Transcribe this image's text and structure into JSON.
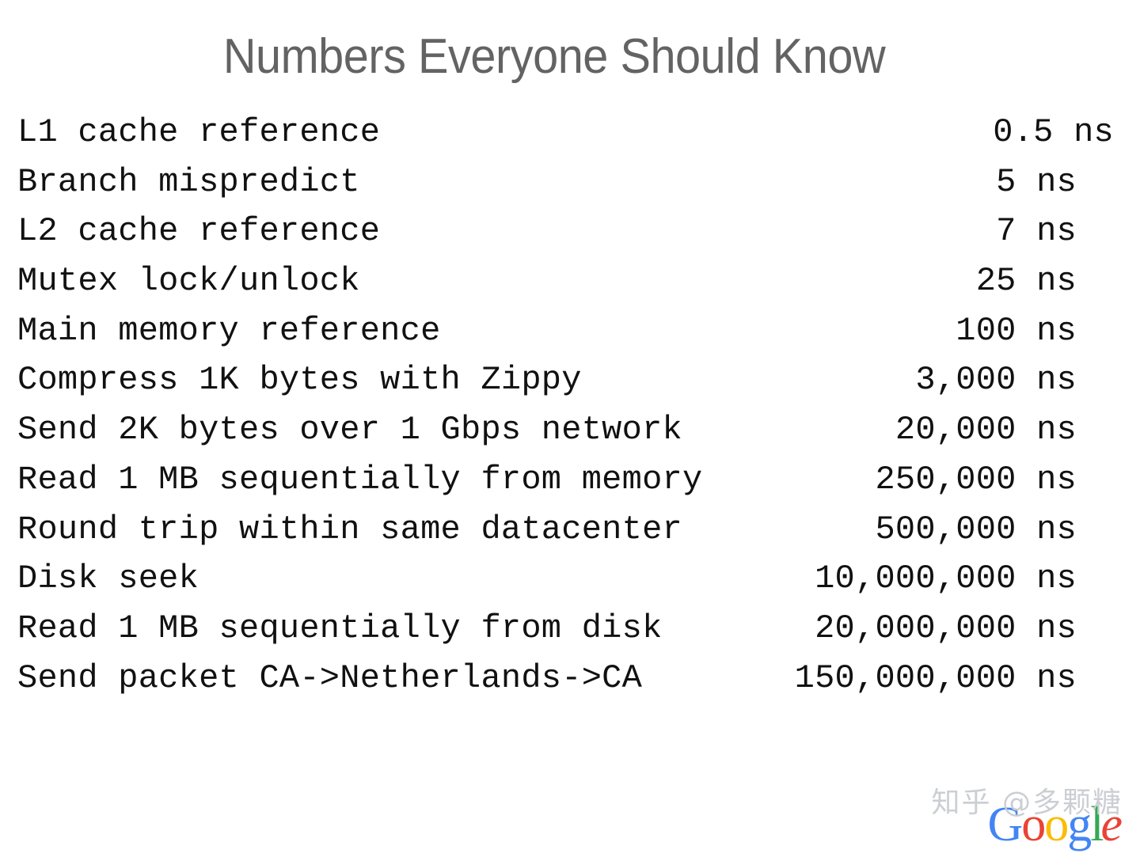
{
  "slide": {
    "title": "Numbers Everyone Should Know",
    "title_color": "#636363",
    "background_color": "#ffffff",
    "body_text_color": "#111111"
  },
  "latency_table": {
    "rows": [
      {
        "operation": "L1 cache reference",
        "value": "0.5 ns"
      },
      {
        "operation": "Branch mispredict",
        "value": "5 ns"
      },
      {
        "operation": "L2 cache reference",
        "value": "7 ns"
      },
      {
        "operation": "Mutex lock/unlock",
        "value": "25 ns"
      },
      {
        "operation": "Main memory reference",
        "value": "100 ns"
      },
      {
        "operation": "Compress 1K bytes with Zippy",
        "value": "3,000 ns"
      },
      {
        "operation": "Send 2K bytes over 1 Gbps network",
        "value": "20,000 ns"
      },
      {
        "operation": "Read 1 MB sequentially from memory",
        "value": "250,000 ns"
      },
      {
        "operation": "Round trip within same datacenter",
        "value": "500,000 ns"
      },
      {
        "operation": "Disk seek",
        "value": "10,000,000 ns"
      },
      {
        "operation": "Read 1 MB sequentially from disk",
        "value": "20,000,000 ns"
      },
      {
        "operation": "Send packet CA->Netherlands->CA",
        "value": "150,000,000 ns"
      }
    ]
  },
  "footer": {
    "watermark": "知乎 @多颗糖",
    "watermark_color": "#c9cdd1",
    "logo": {
      "name": "google-logo",
      "letters": [
        {
          "char": "G",
          "color": "#4285F4"
        },
        {
          "char": "o",
          "color": "#EA4335"
        },
        {
          "char": "o",
          "color": "#FBBC05"
        },
        {
          "char": "g",
          "color": "#4285F4"
        },
        {
          "char": "l",
          "color": "#34A853"
        },
        {
          "char": "e",
          "color": "#EA4335"
        }
      ]
    }
  }
}
